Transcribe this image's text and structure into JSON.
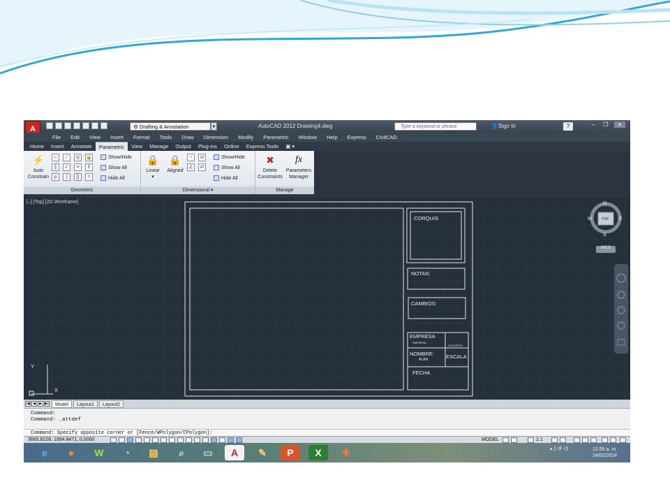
{
  "colors": {
    "app_bg": "#2b3440",
    "drawing_line": "#e4e8ed",
    "autocad_red": "#c62828",
    "swoosh_blue": "#2fa7d9"
  },
  "titlebar": {
    "workspace": "Drafting & Annotation",
    "title": "AutoCAD 2012   Drawing4.dwg",
    "search_placeholder": "Type a keyword or phrase",
    "signin": "Sign In",
    "help": "?"
  },
  "menu": [
    "File",
    "Edit",
    "View",
    "Insert",
    "Format",
    "Tools",
    "Draw",
    "Dimension",
    "Modify",
    "Parametric",
    "Window",
    "Help",
    "Express",
    "CivilCAD"
  ],
  "tabs": [
    "Home",
    "Insert",
    "Annotate",
    "Parametric",
    "View",
    "Manage",
    "Output",
    "Plug-ins",
    "Online",
    "Express Tools"
  ],
  "active_tab": "Parametric",
  "ribbon": {
    "geometric": {
      "title": "Geometric",
      "auto_constrain_line1": "Auto",
      "auto_constrain_line2": "Constrain",
      "show_hide": "Show/Hide",
      "show_all": "Show All",
      "hide_all": "Hide All"
    },
    "dimensional": {
      "title": "Dimensional",
      "linear": "Linear",
      "aligned": "Aligned",
      "show_hide": "Show/Hide",
      "show_all": "Show All",
      "hide_all": "Hide All"
    },
    "manage": {
      "title": "Manage",
      "delete_line1": "Delete",
      "delete_line2": "Constraints",
      "params_line1": "Parameters",
      "params_line2": "Manager",
      "fx": "fx"
    }
  },
  "viewport": {
    "label": "[–] [Top] [2D Wireframe]",
    "viewcube": {
      "n": "N",
      "s": "S",
      "e": "E",
      "w": "W",
      "top": "TOP",
      "wcs": "WCS"
    },
    "ucs": {
      "x": "X",
      "y": "Y"
    }
  },
  "titleblock": {
    "corquis": "CORQUIS",
    "notas": "NOTAS:",
    "cambios": "CAMBIOS:",
    "empresa": "EMPRESA",
    "empresa_small": "EMPRESA",
    "logotipo": "LOGOTIPO",
    "nombre": "NOMBRE:",
    "alan": "ALAN",
    "escala": "ESCALA",
    "fecha": "FECHA"
  },
  "layout_tabs": [
    "Model",
    "Layout1",
    "Layout2"
  ],
  "command": {
    "line1": "Command:",
    "line2": "Command:  _attdef",
    "prompt": "Command: Specify opposite corner or [Fence/WPolygon/CPolygon]:"
  },
  "status": {
    "coords": "3665.8228, 1994.8471, 0.0000",
    "model": "MODEL",
    "scale": "1:1"
  },
  "taskbar": {
    "time": "12:55 a. m.",
    "date": "24/02/2014",
    "icons": [
      "ie-icon",
      "firefox-icon",
      "winzip-icon",
      "speedometer-icon",
      "folder-icon",
      "search-icon",
      "monitor-icon",
      "autocad-icon",
      "paint-icon",
      "powerpoint-icon",
      "excel-icon",
      "puzzle-icon"
    ]
  }
}
